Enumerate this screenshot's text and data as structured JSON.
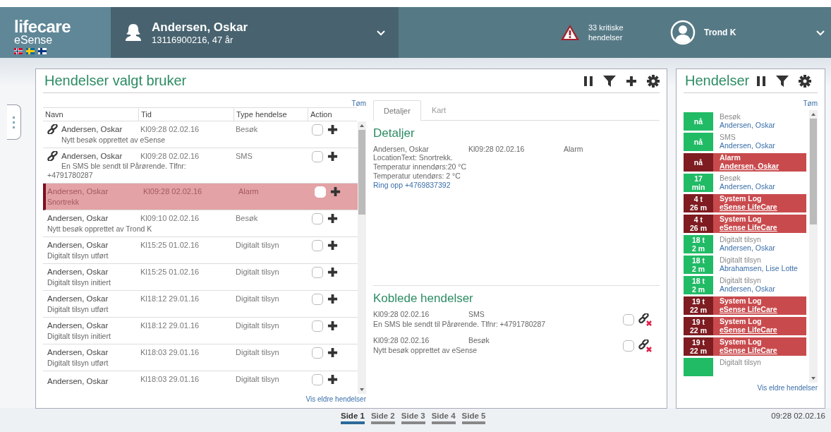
{
  "header": {
    "logo": {
      "name": "lifecare",
      "sub": "eSense"
    },
    "patient": {
      "name": "Andersen, Oskar",
      "info": "13116900216, 47 år"
    },
    "alerts": "33 kritiske hendelser",
    "user": "Trond K"
  },
  "main_panel": {
    "title": "Hendelser valgt bruker",
    "clear_link": "Tøm",
    "columns": [
      "Navn",
      "Tid",
      "Type hendelse",
      "Action"
    ],
    "rows": [
      {
        "name": "Andersen, Oskar",
        "time": "Kl09:28 02.02.16",
        "type": "Besøk",
        "text": "Nytt besøk opprettet av eSense",
        "linked": true,
        "selected": false,
        "checked": false
      },
      {
        "name": "Andersen, Oskar",
        "time": "Kl09:28 02.02.16",
        "type": "SMS",
        "text": "En SMS ble sendt til Pårørende. Tlfnr: +4791780287",
        "linked": true,
        "selected": false,
        "checked": false
      },
      {
        "name": "Andersen, Oskar",
        "time": "Kl09:28 02.02.16",
        "type": "Alarm",
        "text": "Snortrekk",
        "linked": false,
        "selected": true,
        "checked": false
      },
      {
        "name": "Andersen, Oskar",
        "time": "Kl09:10 02.02.16",
        "type": "Besøk",
        "text": "Nytt besøk opprettet av Trond K",
        "linked": false,
        "selected": false,
        "checked": false
      },
      {
        "name": "Andersen, Oskar",
        "time": "Kl15:25 01.02.16",
        "type": "Digitalt tilsyn",
        "text": "Digitalt tilsyn utført",
        "linked": false,
        "selected": false,
        "checked": false
      },
      {
        "name": "Andersen, Oskar",
        "time": "Kl15:25 01.02.16",
        "type": "Digitalt tilsyn",
        "text": "Digitalt tilsyn initiert",
        "linked": false,
        "selected": false,
        "checked": false
      },
      {
        "name": "Andersen, Oskar",
        "time": "Kl18:12 29.01.16",
        "type": "Digitalt tilsyn",
        "text": "Digitalt tilsyn utført",
        "linked": false,
        "selected": false,
        "checked": false
      },
      {
        "name": "Andersen, Oskar",
        "time": "Kl18:12 29.01.16",
        "type": "Digitalt tilsyn",
        "text": "Digitalt tilsyn initiert",
        "linked": false,
        "selected": false,
        "checked": false
      },
      {
        "name": "Andersen, Oskar",
        "time": "Kl18:03 29.01.16",
        "type": "Digitalt tilsyn",
        "text": "Digitalt tilsyn utført",
        "linked": false,
        "selected": false,
        "checked": false
      },
      {
        "name": "Andersen, Oskar",
        "time": "Kl18:03 29.01.16",
        "type": "Digitalt tilsyn",
        "linked": false,
        "selected": false,
        "checked": false
      }
    ],
    "older_link": "Vis eldre hendelser"
  },
  "details": {
    "tabs": [
      {
        "label": "Detaljer",
        "selected": true
      },
      {
        "label": "Kart",
        "selected": false
      }
    ],
    "heading": "Detaljer",
    "name": "Andersen, Oskar",
    "time": "Kl09:28 02.02.16",
    "type": "Alarm",
    "lines": [
      "LocationText: Snortrekk.",
      "Temperatur innendørs:20 °C",
      "Temperatur utendørs: 2 °C"
    ],
    "call_link": "Ring opp +4769837392",
    "linked_heading": "Koblede hendelser",
    "linked": [
      {
        "time": "Kl09:28 02.02.16",
        "type": "SMS",
        "text": "En SMS ble sendt til Pårørende. Tlfnr: +4791780287",
        "checked": false
      },
      {
        "time": "Kl09:28 02.02.16",
        "type": "Besøk",
        "text": "Nytt besøk opprettet av eSense",
        "checked": false
      }
    ]
  },
  "side_panel": {
    "title": "Hendelser",
    "clear_link": "Tøm",
    "older_link": "Vis eldre hendelser",
    "items": [
      {
        "badge": "nå",
        "type": "Besøk",
        "name": "Andersen, Oskar",
        "alarm": false
      },
      {
        "badge": "nå",
        "type": "SMS",
        "name": "Andersen, Oskar",
        "alarm": false
      },
      {
        "badge": "nå",
        "type": "Alarm",
        "name": "Andersen, Oskar",
        "alarm": true
      },
      {
        "badge": "17\nmin",
        "type": "Besøk",
        "name": "Andersen, Oskar",
        "alarm": false
      },
      {
        "badge": "4 t\n26 m",
        "type": "System Log",
        "name": "eSense LifeCare",
        "alarm": true
      },
      {
        "badge": "4 t\n26 m",
        "type": "System Log",
        "name": "eSense LifeCare",
        "alarm": true
      },
      {
        "badge": "18 t\n2 m",
        "type": "Digitalt tilsyn",
        "name": "Andersen, Oskar",
        "alarm": false
      },
      {
        "badge": "18 t\n2 m",
        "type": "Digitalt tilsyn",
        "name": "Abrahamsen, Lise Lotte",
        "alarm": false
      },
      {
        "badge": "18 t\n2 m",
        "type": "Digitalt tilsyn",
        "name": "Andersen, Oskar",
        "alarm": false
      },
      {
        "badge": "19 t\n22 m",
        "type": "System Log",
        "name": "eSense LifeCare",
        "alarm": true
      },
      {
        "badge": "19 t\n22 m",
        "type": "System Log",
        "name": "eSense LifeCare",
        "alarm": true
      },
      {
        "badge": "19 t\n22 m",
        "type": "System Log",
        "name": "eSense LifeCare",
        "alarm": true
      },
      {
        "type": "Digitalt tilsyn",
        "alarm": false
      }
    ]
  },
  "pagination": [
    {
      "label": "Side 1",
      "selected": true
    },
    {
      "label": "Side 2",
      "selected": false
    },
    {
      "label": "Side 3",
      "selected": false
    },
    {
      "label": "Side 4",
      "selected": false
    },
    {
      "label": "Side 5",
      "selected": false
    }
  ],
  "timestamp": "09:28 02.02.16"
}
